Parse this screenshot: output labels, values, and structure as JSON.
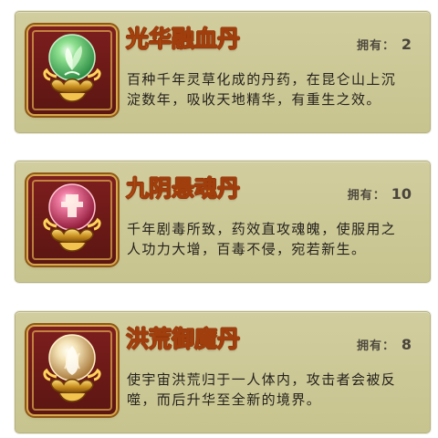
{
  "ui": {
    "owned_label": "拥有："
  },
  "items": [
    {
      "name": "光华融血丹",
      "owned": "2",
      "description": "百种千年灵草化成的丹药，在昆仑山上沉淀数年，吸收天地精华，有重生之效。",
      "icon": "green-orb-icon",
      "orb_color": "#59c56f"
    },
    {
      "name": "九阴悬魂丹",
      "owned": "10",
      "description": "千年剧毒所致，药效直攻魂魄，使服用之人功力大增，百毒不侵，宛若新生。",
      "icon": "red-orb-icon",
      "orb_color": "#c73b55"
    },
    {
      "name": "洪荒御魔丹",
      "owned": "8",
      "description": "使宇宙洪荒归于一人体内，攻击者会被反噬，而后升华至全新的境界。",
      "icon": "gold-orb-icon",
      "orb_color": "#e9d39a"
    }
  ],
  "colors": {
    "card_background": "#cbc793",
    "item_name": "#ffd24a",
    "item_name_outline": "#8a2f08",
    "text": "#24211d",
    "frame": "#6d1b17",
    "frame_gold": "#d9a74d"
  }
}
